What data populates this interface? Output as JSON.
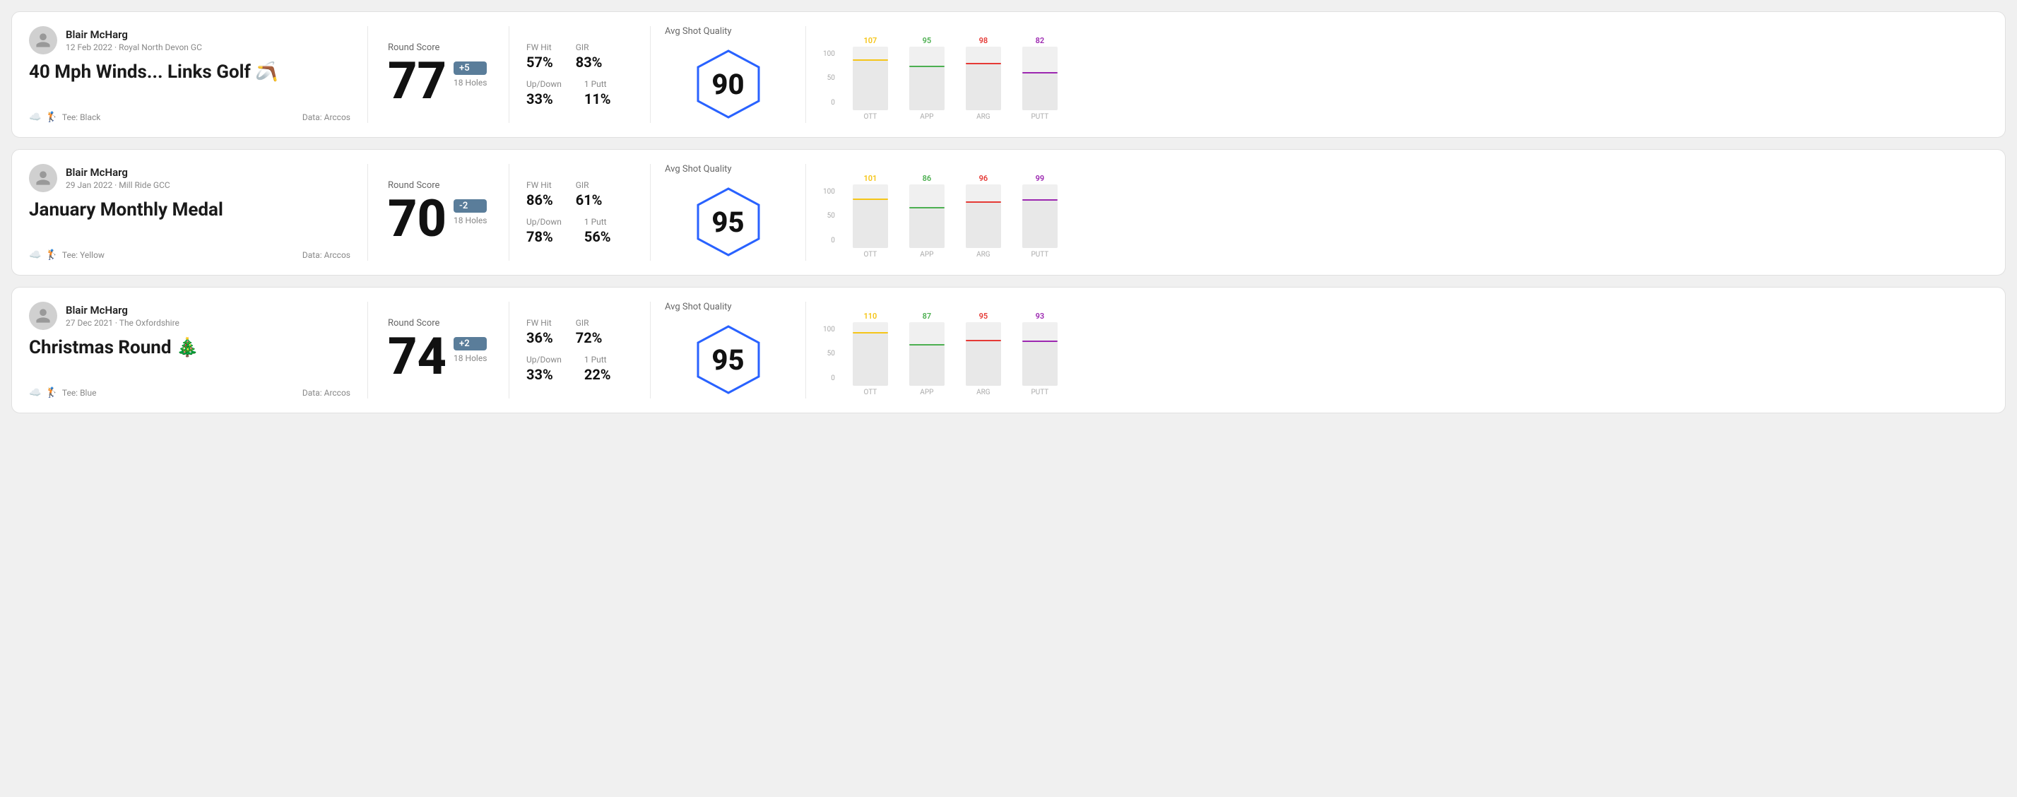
{
  "rounds": [
    {
      "id": "round1",
      "user": {
        "name": "Blair McHarg",
        "meta": "12 Feb 2022 · Royal North Devon GC"
      },
      "title": "40 Mph Winds... Links Golf",
      "title_emoji": "🪃",
      "tee": "Black",
      "data_source": "Data: Arccos",
      "score": {
        "label": "Round Score",
        "number": "77",
        "badge": "+5",
        "badge_type": "plus",
        "holes": "18 Holes"
      },
      "stats": {
        "fw_hit_label": "FW Hit",
        "fw_hit_value": "57%",
        "gir_label": "GIR",
        "gir_value": "83%",
        "updown_label": "Up/Down",
        "updown_value": "33%",
        "oneputt_label": "1 Putt",
        "oneputt_value": "11%"
      },
      "quality": {
        "label": "Avg Shot Quality",
        "score": "90"
      },
      "chart": {
        "bars": [
          {
            "label": "OTT",
            "value": 107,
            "color": "#f5c518",
            "pct": 78
          },
          {
            "label": "APP",
            "value": 95,
            "color": "#4caf50",
            "pct": 68
          },
          {
            "label": "ARG",
            "value": 98,
            "color": "#e53935",
            "pct": 72
          },
          {
            "label": "PUTT",
            "value": 82,
            "color": "#9c27b0",
            "pct": 58
          }
        ],
        "y_labels": [
          "100",
          "50",
          "0"
        ]
      }
    },
    {
      "id": "round2",
      "user": {
        "name": "Blair McHarg",
        "meta": "29 Jan 2022 · Mill Ride GCC"
      },
      "title": "January Monthly Medal",
      "title_emoji": "",
      "tee": "Yellow",
      "data_source": "Data: Arccos",
      "score": {
        "label": "Round Score",
        "number": "70",
        "badge": "-2",
        "badge_type": "minus",
        "holes": "18 Holes"
      },
      "stats": {
        "fw_hit_label": "FW Hit",
        "fw_hit_value": "86%",
        "gir_label": "GIR",
        "gir_value": "61%",
        "updown_label": "Up/Down",
        "updown_value": "78%",
        "oneputt_label": "1 Putt",
        "oneputt_value": "56%"
      },
      "quality": {
        "label": "Avg Shot Quality",
        "score": "95"
      },
      "chart": {
        "bars": [
          {
            "label": "OTT",
            "value": 101,
            "color": "#f5c518",
            "pct": 75
          },
          {
            "label": "APP",
            "value": 86,
            "color": "#4caf50",
            "pct": 62
          },
          {
            "label": "ARG",
            "value": 96,
            "color": "#e53935",
            "pct": 71
          },
          {
            "label": "PUTT",
            "value": 99,
            "color": "#9c27b0",
            "pct": 74
          }
        ],
        "y_labels": [
          "100",
          "50",
          "0"
        ]
      }
    },
    {
      "id": "round3",
      "user": {
        "name": "Blair McHarg",
        "meta": "27 Dec 2021 · The Oxfordshire"
      },
      "title": "Christmas Round",
      "title_emoji": "🎄",
      "tee": "Blue",
      "data_source": "Data: Arccos",
      "score": {
        "label": "Round Score",
        "number": "74",
        "badge": "+2",
        "badge_type": "plus",
        "holes": "18 Holes"
      },
      "stats": {
        "fw_hit_label": "FW Hit",
        "fw_hit_value": "36%",
        "gir_label": "GIR",
        "gir_value": "72%",
        "updown_label": "Up/Down",
        "updown_value": "33%",
        "oneputt_label": "1 Putt",
        "oneputt_value": "22%"
      },
      "quality": {
        "label": "Avg Shot Quality",
        "score": "95"
      },
      "chart": {
        "bars": [
          {
            "label": "OTT",
            "value": 110,
            "color": "#f5c518",
            "pct": 82
          },
          {
            "label": "APP",
            "value": 87,
            "color": "#4caf50",
            "pct": 63
          },
          {
            "label": "ARG",
            "value": 95,
            "color": "#e53935",
            "pct": 70
          },
          {
            "label": "PUTT",
            "value": 93,
            "color": "#9c27b0",
            "pct": 69
          }
        ],
        "y_labels": [
          "100",
          "50",
          "0"
        ]
      }
    }
  ],
  "labels": {
    "tee_prefix": "Tee:",
    "fw_hit": "FW Hit",
    "gir": "GIR",
    "updown": "Up/Down",
    "oneputt": "1 Putt"
  }
}
